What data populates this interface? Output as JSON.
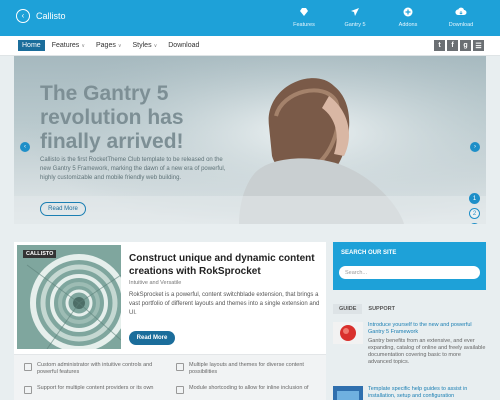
{
  "brand": {
    "name": "Callisto"
  },
  "top_nav": [
    {
      "label": "Features",
      "icon": "diamond-icon"
    },
    {
      "label": "Gantry 5",
      "icon": "rocket-icon"
    },
    {
      "label": "Addons",
      "icon": "plus-circle-icon"
    },
    {
      "label": "Download",
      "icon": "cloud-download-icon"
    }
  ],
  "menu": [
    {
      "label": "Home",
      "active": true,
      "dropdown": false
    },
    {
      "label": "Features",
      "active": false,
      "dropdown": true
    },
    {
      "label": "Pages",
      "active": false,
      "dropdown": true
    },
    {
      "label": "Styles",
      "active": false,
      "dropdown": true
    },
    {
      "label": "Download",
      "active": false,
      "dropdown": false
    }
  ],
  "social": [
    {
      "glyph": "t",
      "icon": "twitter-icon"
    },
    {
      "glyph": "f",
      "icon": "facebook-icon"
    },
    {
      "glyph": "g",
      "icon": "google-plus-icon"
    },
    {
      "glyph": "☰",
      "icon": "rss-icon"
    }
  ],
  "hero": {
    "title": "The Gantry 5 revolution has finally arrived!",
    "text": "Callisto is the first RocketTheme Club template to be released on the new Gantry 5 Framework, marking the dawn of a new era of powerful, highly customizable and mobile friendly web building.",
    "button": "Read More",
    "prev_glyph": "‹",
    "next_glyph": "›",
    "slides": [
      "1",
      "2",
      "3"
    ],
    "active_slide": 1
  },
  "card": {
    "tag": "CALLISTO",
    "title": "Construct unique and dynamic content creations with RokSprocket",
    "subtitle": "Intuitive and Versatile",
    "text": "RokSprocket is a powerful, content switchblade extension, that brings a vast portfolio of different layouts and themes into a single extension and UI.",
    "button": "Read More",
    "features": [
      "Custom administrator with intuitive controls and powerful features",
      "Multiple layouts and themes for diverse content possibilities",
      "Support for multiple content providers or its own",
      "Module shortcoding to allow for inline inclusion of"
    ]
  },
  "sidebar": {
    "search_title": "SEARCH OUR SITE",
    "search_placeholder": "Search...",
    "tabs": [
      {
        "label": "GUIDE",
        "active": true
      },
      {
        "label": "SUPPORT",
        "active": false
      }
    ],
    "posts": [
      {
        "title": "Introduce yourself to the new and powerful Gantry 5 Framework",
        "desc": "Gantry benefits from an extensive, and ever expanding, catalog of online and freely available documentation covering basic to more advanced topics."
      },
      {
        "title": "Template specific help guides to assist in installation, setup and configuration",
        "desc": ""
      }
    ]
  },
  "colors": {
    "accent": "#1ea1d8",
    "dark_accent": "#1b6d9b",
    "hero_title": "#7d8f95",
    "background": "#e8eef0"
  }
}
